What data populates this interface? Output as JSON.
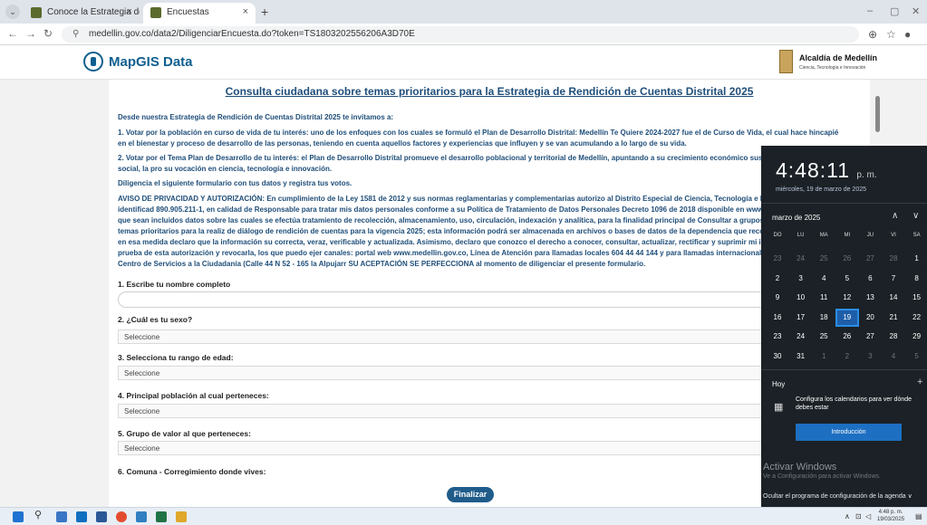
{
  "browser": {
    "tabs": [
      {
        "title": "Conoce la Estrategia de Partici"
      },
      {
        "title": "Encuestas"
      }
    ],
    "new_tab": "+",
    "url": "medellin.gov.co/data2/DiligenciarEncuesta.do?token=TS1803202556206A3D70E"
  },
  "header": {
    "logo": "MapGIS Data",
    "org_name": "Alcaldía de Medellín",
    "org_sub": "Ciencia, Tecnología e Innovación"
  },
  "form": {
    "title": "Consulta ciudadana sobre temas prioritarios para la Estrategia de Rendición de Cuentas Distrital 2025",
    "intro": "Desde nuestra Estrategia de Rendición de Cuentas Distrital 2025 te invitamos a:",
    "point1": "1. Votar por la población en curso de vida de tu interés: uno de los enfoques con los cuales se formuló el Plan de Desarrollo Distrital: Medellín Te Quiere 2024-2027 fue el de Curso de Vida, el cual hace hincapié en el bienestar y proceso de desarrollo de las personas, teniendo en cuenta aquellos factores y experiencias que influyen y se van acumulando a lo largo de su vida.",
    "point2": "2. Votar por el Tema Plan de Desarrollo de tu interés: el Plan de Desarrollo Distrital promueve el desarrollo poblacional y territorial de Medellín, apuntando a su crecimiento económico sustentable, la inclusión social, la pro su vocación en ciencia, tecnología e innovación.",
    "instruction": "Diligencia el siguiente formulario con tus datos y registra tus votos.",
    "privacy": "AVISO DE PRIVACIDAD Y AUTORIZACIÓN: En cumplimiento de la Ley 1581 de 2012 y sus normas reglamentarias y complementarias autorizo al Distrito Especial de Ciencia, Tecnología e Innovación de Medellín identificad 890.905.211-1, en calidad de Responsable para tratar mis datos personales conforme a su Política de Tratamiento de Datos Personales Decreto 1096 de 2018 disponible en www.medellin.gov.co, para que sean incluidos datos sobre las cuales se efectúa tratamiento de recolección, almacenamiento, uso, circulación, indexación y analítica, para la finalidad principal de Consultar a grupos de valor e interés sus temas prioritarios para la realiz de diálogo de rendición de cuentas para la vigencia 2025; esta información podrá ser almacenada en archivos o bases de datos de la dependencia que recopiló la información y en esa medida declaro que la información su correcta, veraz, verificable y actualizada. Asimismo, declaro que conozco el derecho a conocer, consultar, actualizar, rectificar y suprimir mi información, solicitar prueba de esta autorización y revocarla, los que puedo ejer canales: portal web www.medellin.gov.co, Línea de Atención para llamadas locales 604 44 44 144 y para llamadas internacionales (+57) 604 44 44 144, Centro de Servicios a la Ciudadanía (Calle 44 N 52 - 165 la Alpujarr SU ACEPTACIÓN SE PERFECCIONA al momento de diligenciar el presente formulario.",
    "q1": "1. Escribe tu nombre completo",
    "q2": "2. ¿Cuál es tu sexo?",
    "q3": "3. Selecciona tu rango de edad:",
    "q4": "4. Principal población al cual perteneces:",
    "q5": "5. Grupo de valor al que perteneces:",
    "q6": "6. Comuna - Corregimiento donde vives:",
    "select_placeholder": "Seleccione",
    "submit": "Finalizar"
  },
  "calendar": {
    "time": "4:48:11",
    "ampm": "p. m.",
    "date_full": "miércoles, 19 de marzo de 2025",
    "month": "marzo de 2025",
    "weekdays": [
      "DO",
      "LU",
      "MA",
      "MI",
      "JU",
      "VI",
      "SA"
    ],
    "weeks": [
      [
        "23",
        "24",
        "25",
        "26",
        "27",
        "28",
        "1"
      ],
      [
        "2",
        "3",
        "4",
        "5",
        "6",
        "7",
        "8"
      ],
      [
        "9",
        "10",
        "11",
        "12",
        "13",
        "14",
        "15"
      ],
      [
        "16",
        "17",
        "18",
        "19",
        "20",
        "21",
        "22"
      ],
      [
        "23",
        "24",
        "25",
        "26",
        "27",
        "28",
        "29"
      ],
      [
        "30",
        "31",
        "1",
        "2",
        "3",
        "4",
        "5"
      ]
    ],
    "today": "19",
    "today_label": "Hoy",
    "configure_text": "Configura los calendarios para ver dónde debes estar",
    "intro_button": "Introducción",
    "activate_title": "Activar Windows",
    "activate_sub": "Ve a Configuración para activar Windows.",
    "hide_agenda": "Ocultar el programa de configuración de la agenda"
  },
  "taskbar": {
    "clock_time": "4:48 p. m.",
    "clock_date": "19/03/2025"
  }
}
